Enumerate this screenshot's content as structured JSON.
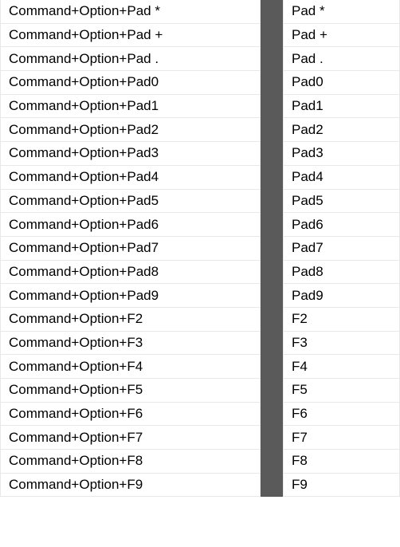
{
  "rows": [
    {
      "shortcut": "Command+Option+Pad *",
      "key": "Pad *"
    },
    {
      "shortcut": "Command+Option+Pad +",
      "key": "Pad +"
    },
    {
      "shortcut": "Command+Option+Pad .",
      "key": "Pad ."
    },
    {
      "shortcut": "Command+Option+Pad0",
      "key": "Pad0"
    },
    {
      "shortcut": "Command+Option+Pad1",
      "key": "Pad1"
    },
    {
      "shortcut": "Command+Option+Pad2",
      "key": "Pad2"
    },
    {
      "shortcut": "Command+Option+Pad3",
      "key": "Pad3"
    },
    {
      "shortcut": "Command+Option+Pad4",
      "key": "Pad4"
    },
    {
      "shortcut": "Command+Option+Pad5",
      "key": "Pad5"
    },
    {
      "shortcut": "Command+Option+Pad6",
      "key": "Pad6"
    },
    {
      "shortcut": "Command+Option+Pad7",
      "key": "Pad7"
    },
    {
      "shortcut": "Command+Option+Pad8",
      "key": "Pad8"
    },
    {
      "shortcut": "Command+Option+Pad9",
      "key": "Pad9"
    },
    {
      "shortcut": "Command+Option+F2",
      "key": "F2"
    },
    {
      "shortcut": "Command+Option+F3",
      "key": "F3"
    },
    {
      "shortcut": "Command+Option+F4",
      "key": "F4"
    },
    {
      "shortcut": "Command+Option+F5",
      "key": "F5"
    },
    {
      "shortcut": "Command+Option+F6",
      "key": "F6"
    },
    {
      "shortcut": "Command+Option+F7",
      "key": "F7"
    },
    {
      "shortcut": "Command+Option+F8",
      "key": "F8"
    },
    {
      "shortcut": "Command+Option+F9",
      "key": "F9"
    }
  ]
}
